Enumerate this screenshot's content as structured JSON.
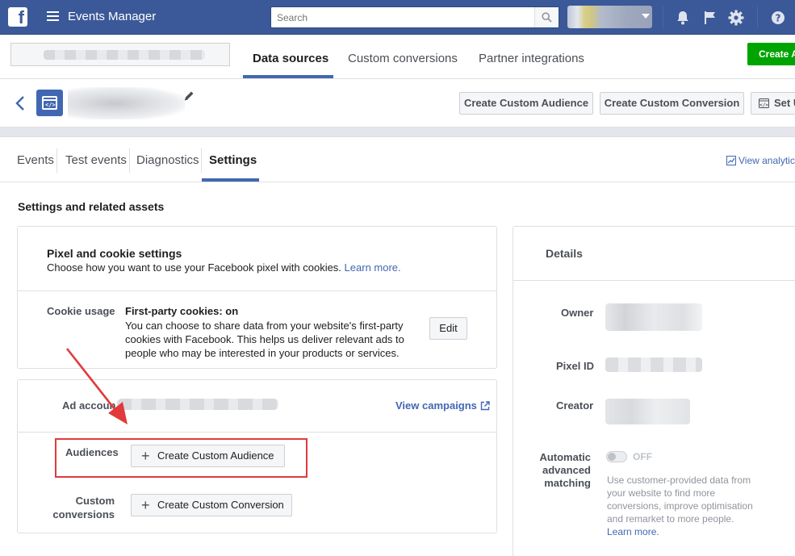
{
  "topbar": {
    "app_title": "Events Manager",
    "search_placeholder": "Search"
  },
  "subheader": {
    "tabs": [
      "Data sources",
      "Custom conversions",
      "Partner integrations"
    ],
    "active_tab": "Data sources",
    "create_button": "Create A"
  },
  "pixel_header": {
    "buttons": [
      "Create Custom Audience",
      "Create Custom Conversion",
      "Set U"
    ]
  },
  "tabs2": {
    "items": [
      "Events",
      "Test events",
      "Diagnostics",
      "Settings"
    ],
    "active": "Settings",
    "view_analytics": "View analytic"
  },
  "main": {
    "section_title": "Settings and related assets",
    "pixel_cookie": {
      "title": "Pixel and cookie settings",
      "subtitle": "Choose how you want to use your Facebook pixel with cookies.",
      "learn_more": "Learn more.",
      "cookie_usage_label": "Cookie usage",
      "cookie_heading": "First-party cookies: on",
      "cookie_desc": "You can choose to share data from your website's first-party cookies with Facebook. This helps us deliver relevant ads to people who may be interested in your products or services.",
      "edit_button": "Edit"
    },
    "assets": {
      "ad_account_label": "Ad accoun",
      "view_campaigns": "View campaigns",
      "audiences_label": "Audiences",
      "create_audience_button": "Create Custom Audience",
      "custom_conversions_label_1": "Custom",
      "custom_conversions_label_2": "conversions",
      "create_conversion_button": "Create Custom Conversion"
    },
    "details": {
      "title": "Details",
      "owner_label": "Owner",
      "pixel_id_label": "Pixel ID",
      "creator_label": "Creator",
      "auto_match_label_1": "Automatic",
      "auto_match_label_2": "advanced",
      "auto_match_label_3": "matching",
      "toggle_state": "OFF",
      "auto_match_desc": "Use customer-provided data from your website to find more conversions, improve optimisation and remarket to more people.",
      "auto_match_learn_more": "Learn more."
    }
  },
  "colors": {
    "topbar": "#3b5998",
    "accent": "#4267b2",
    "create_green": "#00a400",
    "highlight_red": "#e03a3a"
  }
}
